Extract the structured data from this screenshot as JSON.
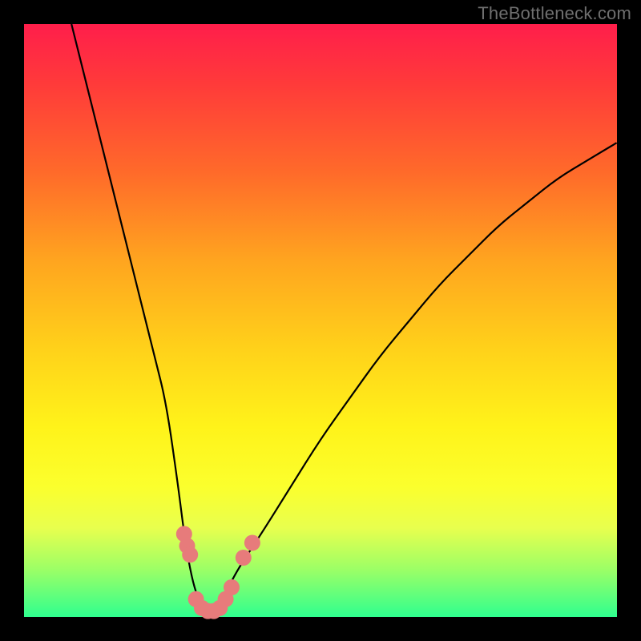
{
  "watermark": "TheBottleneck.com",
  "chart_data": {
    "type": "line",
    "title": "",
    "xlabel": "",
    "ylabel": "",
    "xlim": [
      0,
      100
    ],
    "ylim": [
      0,
      100
    ],
    "series": [
      {
        "name": "bottleneck-curve",
        "x": [
          8,
          10,
          12,
          14,
          16,
          18,
          20,
          22,
          24,
          26,
          27,
          28,
          29,
          30,
          31,
          32,
          33,
          34,
          36,
          40,
          45,
          50,
          55,
          60,
          65,
          70,
          75,
          80,
          85,
          90,
          95,
          100
        ],
        "values": [
          100,
          92,
          84,
          76,
          68,
          60,
          52,
          44,
          36,
          22,
          14,
          8,
          4,
          2,
          1,
          1,
          2,
          4,
          8,
          14,
          22,
          30,
          37,
          44,
          50,
          56,
          61,
          66,
          70,
          74,
          77,
          80
        ]
      }
    ],
    "markers": [
      {
        "name": "cluster-left",
        "x": 27,
        "y": 14
      },
      {
        "name": "cluster-left",
        "x": 27.5,
        "y": 12
      },
      {
        "name": "cluster-left",
        "x": 28,
        "y": 10.5
      },
      {
        "name": "bottom",
        "x": 29,
        "y": 3
      },
      {
        "name": "bottom",
        "x": 30,
        "y": 1.5
      },
      {
        "name": "bottom",
        "x": 31,
        "y": 1
      },
      {
        "name": "bottom",
        "x": 32,
        "y": 1
      },
      {
        "name": "bottom",
        "x": 33,
        "y": 1.5
      },
      {
        "name": "bottom",
        "x": 34,
        "y": 3
      },
      {
        "name": "bottom",
        "x": 35,
        "y": 5
      },
      {
        "name": "cluster-right",
        "x": 37,
        "y": 10
      },
      {
        "name": "cluster-right",
        "x": 38.5,
        "y": 12.5
      }
    ],
    "colors": {
      "curve": "#000000",
      "marker": "#e77b7b"
    }
  }
}
